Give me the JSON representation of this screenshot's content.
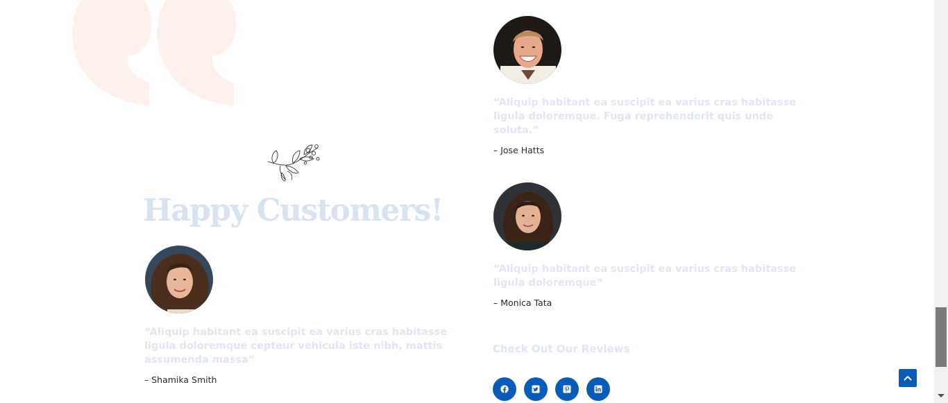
{
  "section": {
    "title": "Happy Customers!",
    "accent_color": "#d9e3ef",
    "quote_mark_color": "#fdf1ee"
  },
  "testimonials": [
    {
      "name": "– Shamika Smith",
      "quote_lines": [
        "“Aliquip habitant ea suscipit ea varius cras habitasse",
        "ligula doloremque cepteur vehicula iste nibh, mattis",
        "assumenda massa”"
      ]
    },
    {
      "name": "– Jose Hatts",
      "quote_lines": [
        "“Aliquip habitant ea suscipit ea varius cras habitasse",
        "ligula doloremque. Fuga reprehenderit quis unde",
        "soluta.”"
      ]
    },
    {
      "name": "– Monica Tata",
      "quote_lines": [
        "“Aliquip habitant ea suscipit ea varius cras habitasse",
        "ligula doloremque”"
      ]
    }
  ],
  "reviews": {
    "heading": "Check Out Our Reviews",
    "brand_color": "#0b5cb8",
    "social_icons": [
      "facebook-icon",
      "twitter-icon",
      "pinterest-icon",
      "linkedin-icon"
    ]
  },
  "scroll_top": {
    "icon": "chevron-up-icon"
  }
}
